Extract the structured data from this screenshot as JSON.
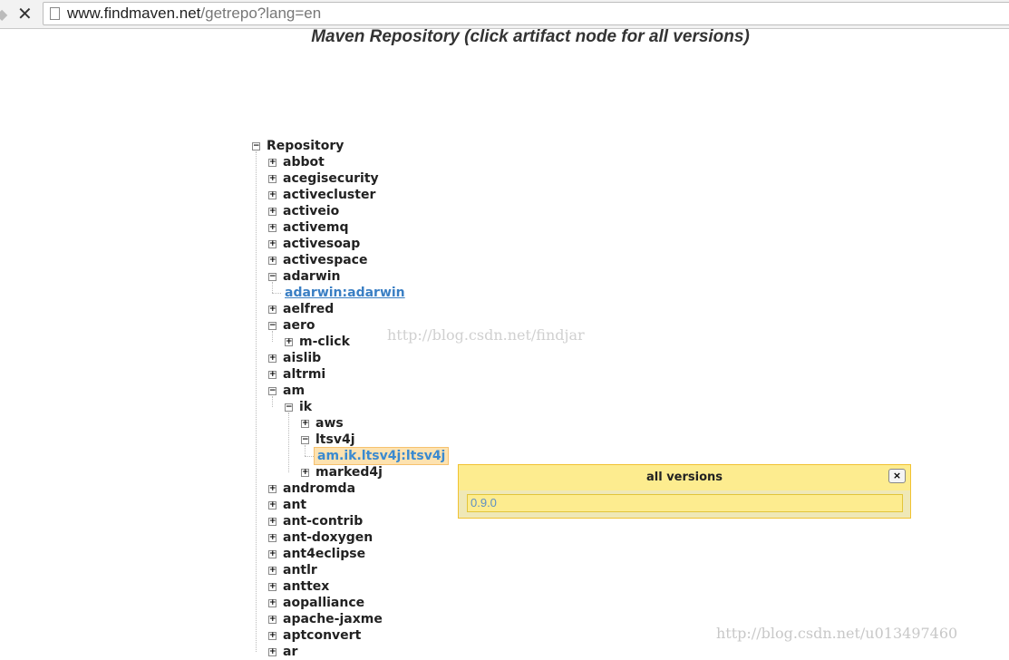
{
  "browser": {
    "url_host": "www.findmaven.net",
    "url_path": "/getrepo?lang=en"
  },
  "title": "Maven Repository (click artifact node for all versions)",
  "tree": [
    {
      "label": "Repository",
      "level": 0,
      "state": "minus"
    },
    {
      "label": "abbot",
      "level": 1,
      "state": "plus"
    },
    {
      "label": "acegisecurity",
      "level": 1,
      "state": "plus"
    },
    {
      "label": "activecluster",
      "level": 1,
      "state": "plus"
    },
    {
      "label": "activeio",
      "level": 1,
      "state": "plus"
    },
    {
      "label": "activemq",
      "level": 1,
      "state": "plus"
    },
    {
      "label": "activesoap",
      "level": 1,
      "state": "plus"
    },
    {
      "label": "activespace",
      "level": 1,
      "state": "plus"
    },
    {
      "label": "adarwin",
      "level": 1,
      "state": "minus"
    },
    {
      "label": "adarwin:adarwin",
      "level": 2,
      "state": "link"
    },
    {
      "label": "aelfred",
      "level": 1,
      "state": "plus"
    },
    {
      "label": "aero",
      "level": 1,
      "state": "minus"
    },
    {
      "label": "m-click",
      "level": 2,
      "state": "plus"
    },
    {
      "label": "aislib",
      "level": 1,
      "state": "plus"
    },
    {
      "label": "altrmi",
      "level": 1,
      "state": "plus"
    },
    {
      "label": "am",
      "level": 1,
      "state": "minus"
    },
    {
      "label": "ik",
      "level": 2,
      "state": "minus"
    },
    {
      "label": "aws",
      "level": 3,
      "state": "plus"
    },
    {
      "label": "ltsv4j",
      "level": 3,
      "state": "minus"
    },
    {
      "label": "am.ik.ltsv4j:ltsv4j",
      "level": 4,
      "state": "selected"
    },
    {
      "label": "marked4j",
      "level": 3,
      "state": "plus"
    },
    {
      "label": "andromda",
      "level": 1,
      "state": "plus"
    },
    {
      "label": "ant",
      "level": 1,
      "state": "plus"
    },
    {
      "label": "ant-contrib",
      "level": 1,
      "state": "plus"
    },
    {
      "label": "ant-doxygen",
      "level": 1,
      "state": "plus"
    },
    {
      "label": "ant4eclipse",
      "level": 1,
      "state": "plus"
    },
    {
      "label": "antlr",
      "level": 1,
      "state": "plus"
    },
    {
      "label": "anttex",
      "level": 1,
      "state": "plus"
    },
    {
      "label": "aopalliance",
      "level": 1,
      "state": "plus"
    },
    {
      "label": "apache-jaxme",
      "level": 1,
      "state": "plus"
    },
    {
      "label": "aptconvert",
      "level": 1,
      "state": "plus"
    },
    {
      "label": "ar",
      "level": 1,
      "state": "plus"
    }
  ],
  "popup": {
    "title": "all versions",
    "close": "×",
    "version": "0.9.0"
  },
  "watermarks": [
    "http://blog.csdn.net/findjar",
    "http://blog.csdn.net/u013497460"
  ]
}
